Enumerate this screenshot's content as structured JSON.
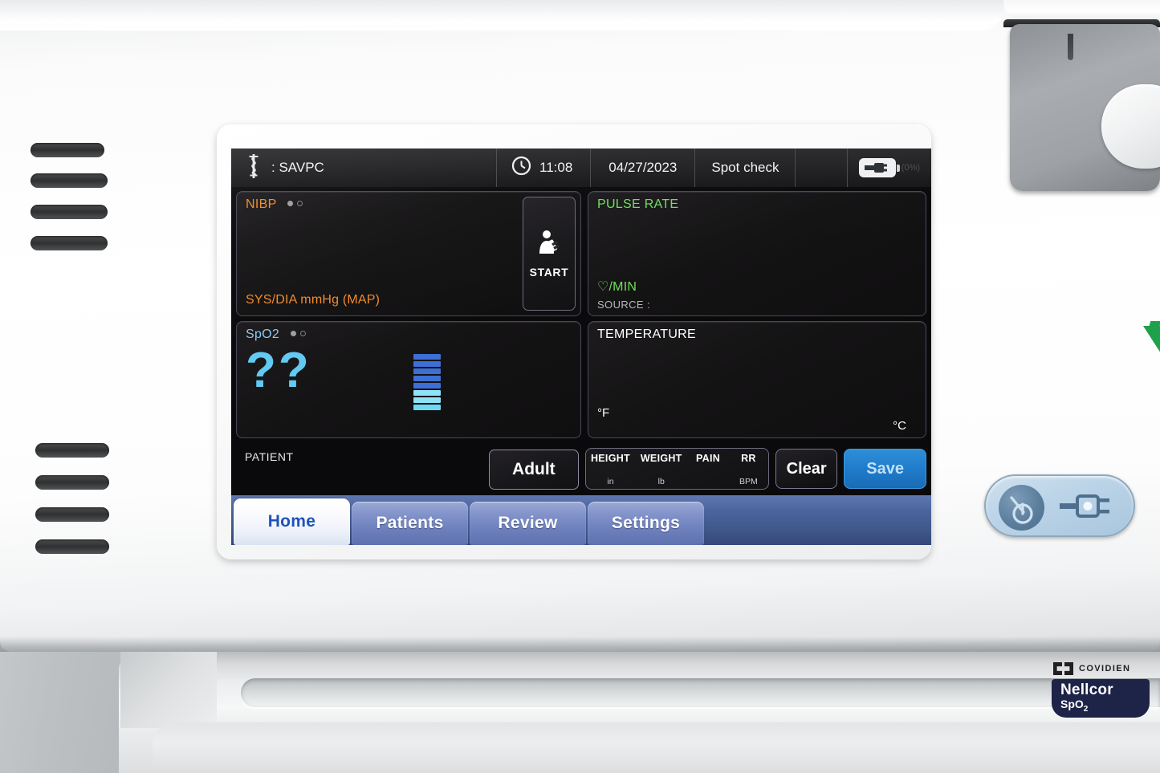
{
  "statusbar": {
    "clinician_icon": "caduceus-icon",
    "clinician": ": SAVPC",
    "clock_icon": "clock-icon",
    "time": "11:08",
    "date": "04/27/2023",
    "mode": "Spot check",
    "battery_icon": "battery-plug-icon",
    "battery_percent": "(0%)"
  },
  "nibp": {
    "label": "NIBP",
    "units": "SYS/DIA mmHg (MAP)",
    "value": "",
    "start_label": "START",
    "start_icon": "patient-cuff-icon",
    "color": "#f08a2a"
  },
  "pulse": {
    "label": "PULSE RATE",
    "units": "♡/MIN",
    "source": "SOURCE :",
    "value": "",
    "color": "#6ee05a"
  },
  "spo2": {
    "label": "SpO2",
    "value": "??",
    "bar_icon": "signal-bars-icon",
    "bars": [
      "#3d6fd6",
      "#3d6fd6",
      "#3d6fd6",
      "#3d6fd6",
      "#3d6fd6",
      "#8fe2f7",
      "#8fe2f7",
      "#6fd8f2"
    ],
    "color": "#62c9f2"
  },
  "temperature": {
    "label": "TEMPERATURE",
    "value": "",
    "unit_f": "°F",
    "unit_c": "°C",
    "color": "#ffffff"
  },
  "patient": {
    "label": "PATIENT",
    "type_button": "Adult"
  },
  "fields": {
    "headers": [
      "HEIGHT",
      "WEIGHT",
      "PAIN",
      "RR"
    ],
    "values": [
      "",
      "",
      "",
      ""
    ],
    "units": [
      "in",
      "lb",
      "",
      "BPM"
    ]
  },
  "actions": {
    "clear_label": "Clear",
    "save_label": "Save",
    "save_color": "#1f7ccb"
  },
  "tabs": [
    {
      "label": "Home",
      "active": true
    },
    {
      "label": "Patients",
      "active": false
    },
    {
      "label": "Review",
      "active": false
    },
    {
      "label": "Settings",
      "active": false
    }
  ],
  "device": {
    "brand": "COVIDIEN",
    "module_name": "Nellcor",
    "module_sub": "SpO",
    "module_sub_digit": "2",
    "power_icon": "power-button-icon",
    "plug_icon": "ac-plug-icon",
    "logo_icon": "green-chevron-logo"
  }
}
